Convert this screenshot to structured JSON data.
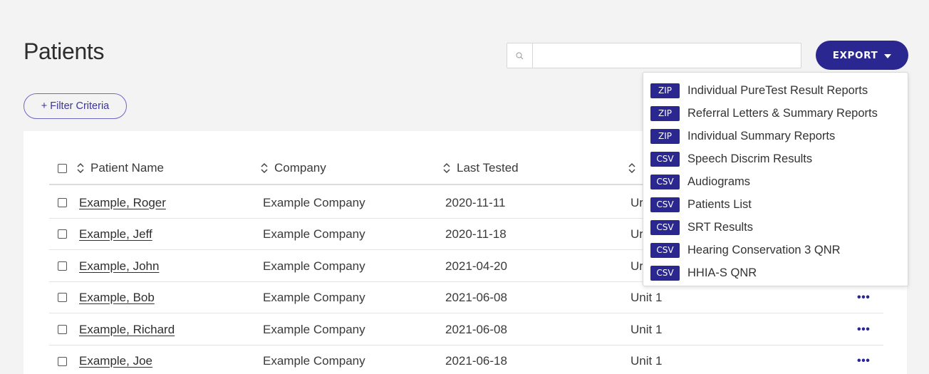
{
  "page": {
    "title": "Patients"
  },
  "search": {
    "placeholder": "",
    "value": ""
  },
  "export": {
    "label": "EXPORT"
  },
  "filter": {
    "label": "+ Filter Criteria"
  },
  "table": {
    "columns": [
      "Patient Name",
      "Company",
      "Last Tested",
      ""
    ],
    "rows": [
      {
        "name": "Example, Roger",
        "company": "Example Company",
        "last_tested": "2020-11-11",
        "location": "Ur"
      },
      {
        "name": "Example, Jeff",
        "company": "Example Company",
        "last_tested": "2020-11-18",
        "location": "Ur"
      },
      {
        "name": "Example, John",
        "company": "Example Company",
        "last_tested": "2021-04-20",
        "location": "Ur"
      },
      {
        "name": "Example, Bob",
        "company": "Example Company",
        "last_tested": "2021-06-08",
        "location": "Unit 1"
      },
      {
        "name": "Example, Richard",
        "company": "Example Company",
        "last_tested": "2021-06-08",
        "location": "Unit 1"
      },
      {
        "name": "Example, Joe",
        "company": "Example Company",
        "last_tested": "2021-06-18",
        "location": "Unit 1"
      }
    ],
    "more_label": "•••"
  },
  "export_menu": {
    "items": [
      {
        "badge": "ZIP",
        "label": "Individual PureTest Result Reports"
      },
      {
        "badge": "ZIP",
        "label": "Referral Letters & Summary Reports"
      },
      {
        "badge": "ZIP",
        "label": "Individual Summary Reports"
      },
      {
        "badge": "CSV",
        "label": "Speech Discrim Results"
      },
      {
        "badge": "CSV",
        "label": "Audiograms"
      },
      {
        "badge": "CSV",
        "label": "Patients List"
      },
      {
        "badge": "CSV",
        "label": "SRT Results"
      },
      {
        "badge": "CSV",
        "label": "Hearing Conservation 3 QNR"
      },
      {
        "badge": "CSV",
        "label": "HHIA-S QNR"
      }
    ]
  },
  "colors": {
    "accent": "#2b2790",
    "background": "#f3f3f3",
    "card": "#ffffff"
  },
  "icons": {
    "search": "search-icon",
    "sort": "sort-icon",
    "caret": "caret-down-icon",
    "more": "more-horizontal-icon"
  }
}
